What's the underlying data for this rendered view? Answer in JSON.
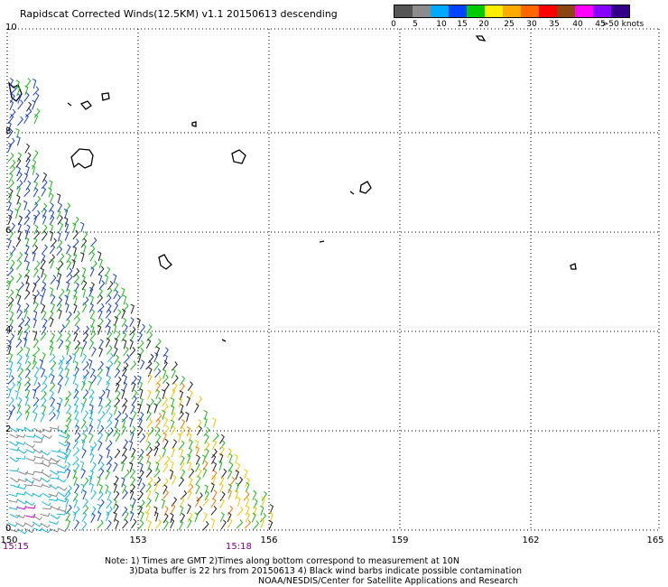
{
  "title": "Rapidscat Corrected Winds(12.5KM) v1.1 20150613 descending",
  "legend": {
    "colors": [
      "#555555",
      "#8c8c8c",
      "#00aaff",
      "#0044ff",
      "#00cc00",
      "#ffee00",
      "#ffaa00",
      "#ff6600",
      "#ff0000",
      "#8b4513",
      "#ff00ff",
      "#8800ff",
      "#330088"
    ],
    "labels": [
      "0",
      "5",
      "10",
      "15",
      "20",
      "25",
      "30",
      "35",
      "40",
      "45",
      ">50 knots"
    ]
  },
  "map": {
    "lat_labels": [
      "10",
      "8",
      "6",
      "4",
      "2",
      "0"
    ],
    "lon_labels": [
      "150",
      "153",
      "156",
      "159",
      "162",
      "165"
    ],
    "time_labels": [
      "15:15",
      "15:18"
    ],
    "lon_range": [
      150,
      165
    ],
    "lat_range": [
      0,
      10
    ]
  },
  "notes": [
    "Note: 1) Times are GMT 2)Times along bottom correspond to measurement at 10N",
    "3)Data buffer is 22 hrs from 20150613 4) Black wind barbs indicate possible contamination",
    "NOAA/NESDIS/Center for Satellite Applications and Research"
  ]
}
